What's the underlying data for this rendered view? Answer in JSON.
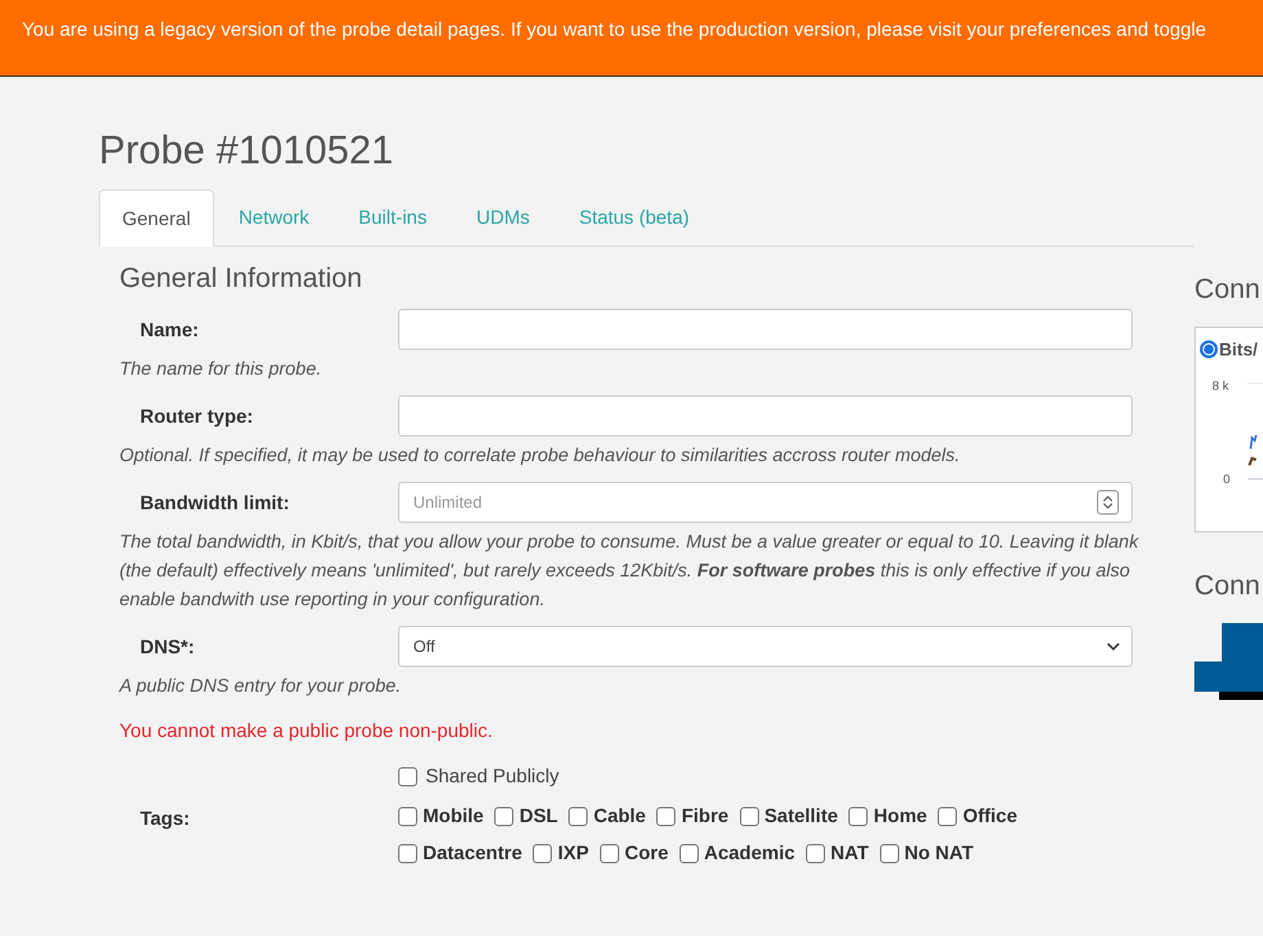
{
  "banner": {
    "text": "You are using a legacy version of the probe detail pages. If you want to use the production version, please visit your preferences and toggle"
  },
  "title": "Probe #1010521",
  "tabs": [
    {
      "label": "General",
      "selected": true
    },
    {
      "label": "Network",
      "selected": false
    },
    {
      "label": "Built-ins",
      "selected": false
    },
    {
      "label": "UDMs",
      "selected": false
    },
    {
      "label": "Status (beta)",
      "selected": false
    }
  ],
  "section_title": "General Information",
  "fields": [
    {
      "kind": "text",
      "label": "Name:",
      "help": "The name for this probe."
    },
    {
      "kind": "text",
      "label": "Router type:",
      "help": "Optional. If specified, it may be used to correlate probe behaviour to similarities accross router models."
    },
    {
      "kind": "number",
      "label": "Bandwidth limit:",
      "placeholder": "Unlimited",
      "help": "The total bandwidth, in Kbit/s, that you allow your probe to consume. Must be a value greater or equal to 10. Leaving it blank (the default) effectively means 'unlimited', but rarely exceeds 12Kbit/s. **For software probes** this is only effective if you also enable bandwith use reporting in your configuration."
    },
    {
      "kind": "select",
      "label": "DNS*:",
      "value": "Off",
      "help": "A public DNS entry for your probe."
    }
  ],
  "error": "You cannot make a public probe non-public.",
  "shared": {
    "label": "Shared Publicly",
    "checked": false
  },
  "tags": {
    "label": "Tags:",
    "items": [
      {
        "label": "Mobile",
        "checked": false
      },
      {
        "label": "DSL",
        "checked": false
      },
      {
        "label": "Cable",
        "checked": false
      },
      {
        "label": "Fibre",
        "checked": false
      },
      {
        "label": "Satellite",
        "checked": false
      },
      {
        "label": "Home",
        "checked": false
      },
      {
        "label": "Office",
        "checked": false
      },
      {
        "label": "Datacentre",
        "checked": false
      },
      {
        "label": "IXP",
        "checked": false
      },
      {
        "label": "Core",
        "checked": false
      },
      {
        "label": "Academic",
        "checked": false
      },
      {
        "label": "NAT",
        "checked": false
      },
      {
        "label": "No NAT",
        "checked": false
      }
    ]
  },
  "side": {
    "heading_1": "Conn",
    "radio": {
      "label": "Bits/",
      "selected": true
    },
    "axis": [
      "8 k",
      "0"
    ],
    "heading_2": "Conn"
  }
}
